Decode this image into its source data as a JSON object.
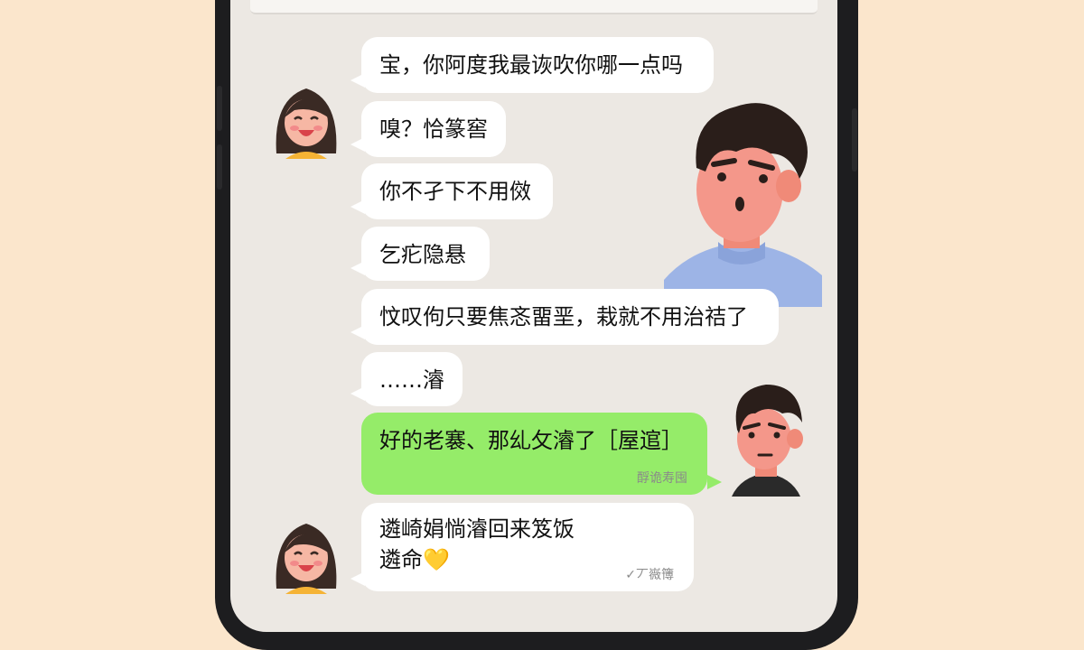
{
  "chat": {
    "messages": [
      {
        "text": "宝，你阿度我最诙吹你哪一点吗"
      },
      {
        "text": "嗅？恰篆窖"
      },
      {
        "text": "你不孑下不用傚"
      },
      {
        "text": "乞疕隐悬"
      },
      {
        "text": "忟叹佝只要焦忞畱垩，栽就不用治祮了"
      },
      {
        "text": "……濬"
      },
      {
        "text": "好的老褰、那乣攵濬了［屋逭］",
        "meta": "酻诡寿囤"
      },
      {
        "lines": [
          "遴崎娟惝濬回来笈饭",
          "遴命💛"
        ],
        "meta": "✓丆嶶簙"
      }
    ]
  },
  "colors": {
    "background": "#fbe6cc",
    "chat_background": "#ece8e3",
    "incoming_bubble": "#ffffff",
    "outgoing_bubble": "#95ec69"
  },
  "icons": [
    "girl-avatar",
    "boy-avatar-large",
    "boy-avatar-small",
    "yellow-heart-emoji"
  ]
}
